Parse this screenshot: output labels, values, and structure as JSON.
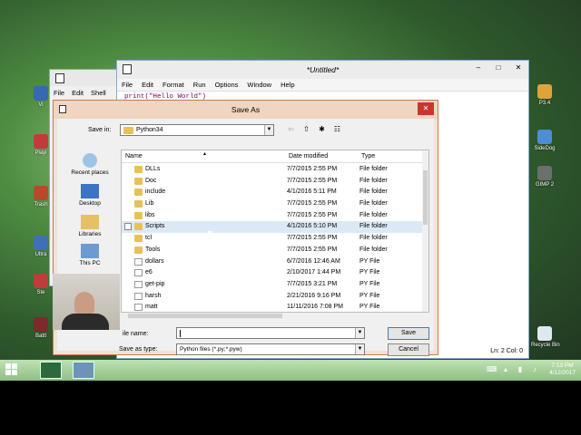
{
  "desktop_icons_left": [
    {
      "label": "Vi"
    },
    {
      "label": "Playi"
    },
    {
      "label": "Trash"
    },
    {
      "label": "Ultra"
    },
    {
      "label": "Ste"
    },
    {
      "label": "Battl"
    }
  ],
  "desktop_icons_right": [
    {
      "label": "P3.4"
    },
    {
      "label": "SideDog"
    },
    {
      "label": "GIMP 2"
    },
    {
      "label": "Recycle Bin"
    }
  ],
  "shell_window": {
    "menu": [
      "File",
      "Edit",
      "Shell"
    ]
  },
  "editor_window": {
    "title": "*Untitled*",
    "menu": [
      "File",
      "Edit",
      "Format",
      "Run",
      "Options",
      "Window",
      "Help"
    ],
    "code": "print(\"Hello World\")",
    "status": "Ln: 2 Col: 0",
    "controls": [
      "–",
      "□",
      "✕"
    ]
  },
  "dialog": {
    "title": "Save As",
    "close": "✕",
    "save_in_label": "Save in:",
    "save_in_value": "Python34",
    "places": [
      {
        "label": "Recent places",
        "icon": "recent-places-icon"
      },
      {
        "label": "Desktop",
        "icon": "desktop-icon"
      },
      {
        "label": "Libraries",
        "icon": "libraries-icon"
      },
      {
        "label": "This PC",
        "icon": "this-pc-icon"
      }
    ],
    "columns": {
      "name": "Name",
      "date": "Date modified",
      "type": "Type"
    },
    "files": [
      {
        "name": "DLLs",
        "date": "7/7/2015 2:55 PM",
        "type": "File folder",
        "kind": "folder"
      },
      {
        "name": "Doc",
        "date": "7/7/2015 2:55 PM",
        "type": "File folder",
        "kind": "folder"
      },
      {
        "name": "include",
        "date": "4/1/2016 5:11 PM",
        "type": "File folder",
        "kind": "folder"
      },
      {
        "name": "Lib",
        "date": "7/7/2015 2:55 PM",
        "type": "File folder",
        "kind": "folder"
      },
      {
        "name": "libs",
        "date": "7/7/2015 2:55 PM",
        "type": "File folder",
        "kind": "folder"
      },
      {
        "name": "Scripts",
        "date": "4/1/2016 5:10 PM",
        "type": "File folder",
        "kind": "folder",
        "selected": true
      },
      {
        "name": "tcl",
        "date": "7/7/2015 2:55 PM",
        "type": "File folder",
        "kind": "folder"
      },
      {
        "name": "Tools",
        "date": "7/7/2015 2:55 PM",
        "type": "File folder",
        "kind": "folder"
      },
      {
        "name": "dollars",
        "date": "6/7/2016 12:46 AM",
        "type": "PY File",
        "kind": "py"
      },
      {
        "name": "e6",
        "date": "2/10/2017 1:44 PM",
        "type": "PY File",
        "kind": "py"
      },
      {
        "name": "get-pip",
        "date": "7/7/2015 3:21 PM",
        "type": "PY File",
        "kind": "py"
      },
      {
        "name": "harsh",
        "date": "2/21/2016 9:16 PM",
        "type": "PY File",
        "kind": "py"
      },
      {
        "name": "matt",
        "date": "11/11/2016 7:08 PM",
        "type": "PY File",
        "kind": "py"
      }
    ],
    "file_name_label": "ile name:",
    "file_name_value": "",
    "save_as_type_label": "Save as type:",
    "save_as_type_value": "Python files (*.py;*.pyw)",
    "save_button": "Save",
    "cancel_button": "Cancel"
  },
  "taskbar": {
    "time": "7:13 PM",
    "date": "4/12/2017"
  }
}
